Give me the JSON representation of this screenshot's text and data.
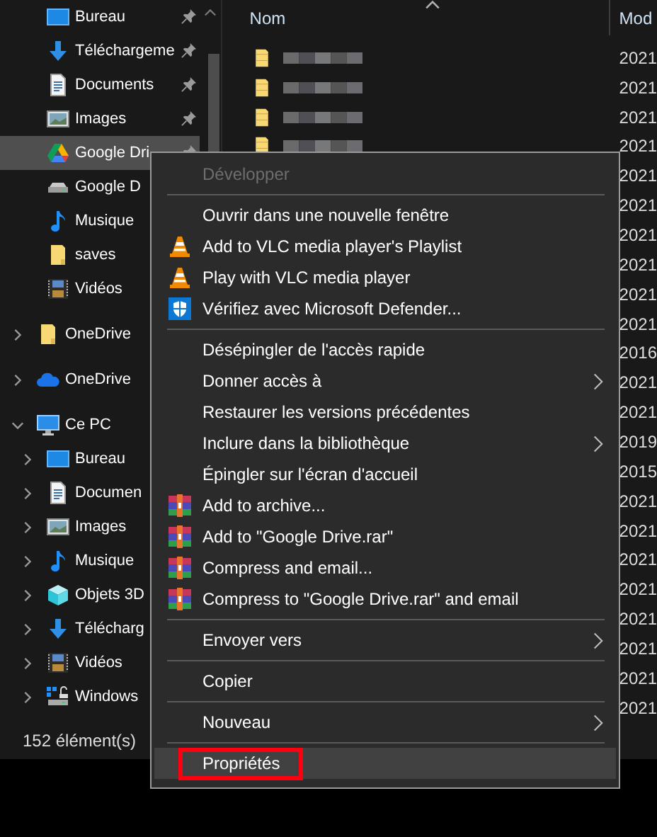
{
  "sidebar": {
    "quick_access": [
      {
        "label": "Bureau",
        "kind": "desktop",
        "pinned": true,
        "selected": false
      },
      {
        "label": "Téléchargeme",
        "kind": "download",
        "pinned": true,
        "selected": false
      },
      {
        "label": "Documents",
        "kind": "document",
        "pinned": true,
        "selected": false
      },
      {
        "label": "Images",
        "kind": "image",
        "pinned": true,
        "selected": false
      },
      {
        "label": "Google Dri",
        "kind": "gdrive",
        "pinned": true,
        "selected": true
      },
      {
        "label": "Google D",
        "kind": "drive",
        "pinned": false,
        "selected": false
      },
      {
        "label": "Musique",
        "kind": "music",
        "pinned": false,
        "selected": false
      },
      {
        "label": "saves",
        "kind": "folder",
        "pinned": false,
        "selected": false
      },
      {
        "label": "Vidéos",
        "kind": "video",
        "pinned": false,
        "selected": false
      }
    ],
    "tree": [
      {
        "label": "OneDrive",
        "kind": "folder",
        "expanded": false,
        "selected": false
      },
      {
        "label": "OneDrive",
        "kind": "cloud",
        "expanded": false,
        "selected": false
      },
      {
        "label": "Ce PC",
        "kind": "pc",
        "expanded": true,
        "selected": false,
        "children": [
          {
            "label": "Bureau",
            "kind": "desktop",
            "expanded": false,
            "selected": false
          },
          {
            "label": "Documen",
            "kind": "document",
            "expanded": false,
            "selected": false
          },
          {
            "label": "Images",
            "kind": "image",
            "expanded": false,
            "selected": false
          },
          {
            "label": "Musique",
            "kind": "music",
            "expanded": false,
            "selected": false
          },
          {
            "label": "Objets 3D",
            "kind": "cube",
            "expanded": false,
            "selected": false
          },
          {
            "label": "Télécharg",
            "kind": "download",
            "expanded": false,
            "selected": false
          },
          {
            "label": "Vidéos",
            "kind": "video",
            "expanded": false,
            "selected": false
          },
          {
            "label": "Windows",
            "kind": "netdrive",
            "expanded": false,
            "selected": false
          }
        ]
      }
    ]
  },
  "file_list": {
    "columns": [
      {
        "label": "Nom",
        "sorted": true
      },
      {
        "label": "Mod",
        "sorted": false
      }
    ],
    "rows": [
      {
        "kind": "folder",
        "date": "2021"
      },
      {
        "kind": "folder",
        "date": "2021"
      },
      {
        "kind": "folder",
        "date": "2021"
      },
      {
        "kind": "folder",
        "date": "2021"
      },
      {
        "kind": "covered",
        "date": "2021"
      },
      {
        "kind": "covered",
        "date": "2021"
      },
      {
        "kind": "covered",
        "date": "2021"
      },
      {
        "kind": "covered",
        "date": "2021"
      },
      {
        "kind": "covered",
        "date": "2021"
      },
      {
        "kind": "covered",
        "date": "2021"
      },
      {
        "kind": "covered",
        "date": "2016"
      },
      {
        "kind": "covered",
        "date": "2021"
      },
      {
        "kind": "covered",
        "date": "2021"
      },
      {
        "kind": "covered",
        "date": "2019"
      },
      {
        "kind": "covered",
        "date": "2015"
      },
      {
        "kind": "covered",
        "date": "2021"
      },
      {
        "kind": "covered",
        "date": "2021"
      },
      {
        "kind": "covered",
        "date": "2021"
      },
      {
        "kind": "covered",
        "date": "2021"
      },
      {
        "kind": "covered",
        "date": "2021"
      },
      {
        "kind": "covered",
        "date": "2021"
      },
      {
        "kind": "covered",
        "date": "2021"
      },
      {
        "kind": "covered",
        "date": "2021"
      }
    ]
  },
  "status_bar": {
    "item_count": "152 élément(s)"
  },
  "context_menu": [
    {
      "kind": "item",
      "label": "Développer",
      "disabled": true
    },
    {
      "kind": "separator"
    },
    {
      "kind": "item",
      "label": "Ouvrir dans une nouvelle fenêtre"
    },
    {
      "kind": "vlc",
      "label": "Add to VLC media player's Playlist"
    },
    {
      "kind": "vlc",
      "label": "Play with VLC media player"
    },
    {
      "kind": "defender",
      "label": "Vérifiez avec Microsoft Defender..."
    },
    {
      "kind": "separator"
    },
    {
      "kind": "item",
      "label": "Désépingler de l'accès rapide"
    },
    {
      "kind": "item",
      "label": "Donner accès à",
      "submenu": true
    },
    {
      "kind": "item",
      "label": "Restaurer les versions précédentes"
    },
    {
      "kind": "item",
      "label": "Inclure dans la bibliothèque",
      "submenu": true
    },
    {
      "kind": "item",
      "label": "Épingler sur l'écran d'accueil"
    },
    {
      "kind": "winrar",
      "label": "Add to archive..."
    },
    {
      "kind": "winrar",
      "label": "Add to \"Google Drive.rar\""
    },
    {
      "kind": "winrar",
      "label": "Compress and email..."
    },
    {
      "kind": "winrar",
      "label": "Compress to \"Google Drive.rar\" and email"
    },
    {
      "kind": "separator"
    },
    {
      "kind": "item",
      "label": "Envoyer vers",
      "submenu": true
    },
    {
      "kind": "separator"
    },
    {
      "kind": "item",
      "label": "Copier"
    },
    {
      "kind": "separator"
    },
    {
      "kind": "item",
      "label": "Nouveau",
      "submenu": true
    },
    {
      "kind": "separator"
    },
    {
      "kind": "item",
      "label": "Propriétés",
      "selected": true,
      "annotated": true
    }
  ]
}
